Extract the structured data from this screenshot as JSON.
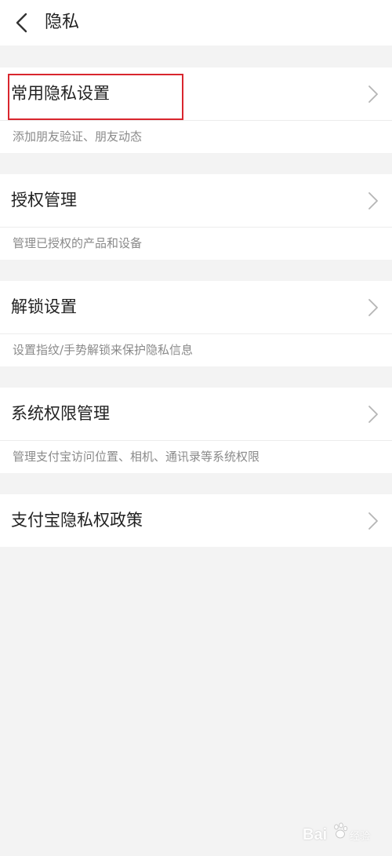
{
  "header": {
    "title": "隐私",
    "back_icon": "chevron-left-icon"
  },
  "sections": [
    {
      "label": "常用隐私设置",
      "description": "添加朋友验证、朋友动态"
    },
    {
      "label": "授权管理",
      "description": "管理已授权的产品和设备"
    },
    {
      "label": "解锁设置",
      "description": "设置指纹/手势解锁来保护隐私信息"
    },
    {
      "label": "系统权限管理",
      "description": "管理支付宝访问位置、相机、通讯录等系统权限"
    },
    {
      "label": "支付宝隐私权政策"
    }
  ],
  "watermark": {
    "brand": "Bai",
    "suffix": "经验"
  },
  "colors": {
    "background": "#f3f3f3",
    "card": "#ffffff",
    "highlight": "#d9262e",
    "description": "#8a8a8a"
  }
}
